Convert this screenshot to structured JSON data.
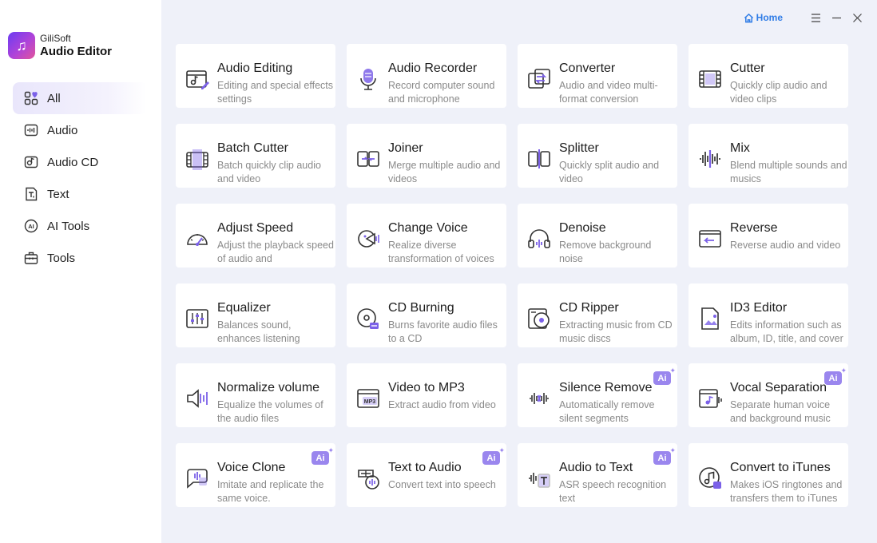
{
  "brand": {
    "company": "GiliSoft",
    "product": "Audio Editor"
  },
  "titlebar": {
    "home_label": "Home"
  },
  "sidebar": {
    "items": [
      {
        "label": "All",
        "icon": "grid-icon",
        "active": true
      },
      {
        "label": "Audio",
        "icon": "audio-icon"
      },
      {
        "label": "Audio CD",
        "icon": "cd-icon"
      },
      {
        "label": "Text",
        "icon": "text-icon"
      },
      {
        "label": "AI Tools",
        "icon": "ai-icon"
      },
      {
        "label": "Tools",
        "icon": "toolbox-icon"
      }
    ]
  },
  "tools": [
    {
      "title": "Audio Editing",
      "desc": "Editing and special effects settings",
      "icon": "audio-editing-icon",
      "ai": false
    },
    {
      "title": "Audio Recorder",
      "desc": "Record computer sound and microphone",
      "icon": "microphone-icon",
      "ai": false
    },
    {
      "title": "Converter",
      "desc": "Audio and video multi-format conversion",
      "icon": "converter-icon",
      "ai": false
    },
    {
      "title": "Cutter",
      "desc": "Quickly clip audio and video clips",
      "icon": "film-cut-icon",
      "ai": false
    },
    {
      "title": "Batch Cutter",
      "desc": "Batch quickly clip audio and video",
      "icon": "batch-cut-icon",
      "ai": false
    },
    {
      "title": "Joiner",
      "desc": "Merge multiple audio and videos",
      "icon": "joiner-icon",
      "ai": false
    },
    {
      "title": "Splitter",
      "desc": "Quickly split audio and video",
      "icon": "splitter-icon",
      "ai": false
    },
    {
      "title": "Mix",
      "desc": "Blend multiple sounds and musics",
      "icon": "waveform-icon",
      "ai": false
    },
    {
      "title": "Adjust Speed",
      "desc": "Adjust the playback speed of audio and",
      "icon": "speedometer-icon",
      "ai": false
    },
    {
      "title": "Change Voice",
      "desc": "Realize diverse transformation of voices",
      "icon": "voice-change-icon",
      "ai": false
    },
    {
      "title": "Denoise",
      "desc": "Remove background noise",
      "icon": "headphones-icon",
      "ai": false
    },
    {
      "title": "Reverse",
      "desc": "Reverse audio and video",
      "icon": "reverse-icon",
      "ai": false
    },
    {
      "title": "Equalizer",
      "desc": "Balances sound, enhances listening",
      "icon": "equalizer-icon",
      "ai": false
    },
    {
      "title": "CD Burning",
      "desc": "Burns favorite audio files to a CD",
      "icon": "cd-burn-icon",
      "ai": false
    },
    {
      "title": "CD Ripper",
      "desc": "Extracting music from CD music discs",
      "icon": "cd-ripper-icon",
      "ai": false
    },
    {
      "title": "ID3 Editor",
      "desc": "Edits information such as album, ID, title, and cover",
      "icon": "id3-icon",
      "ai": false
    },
    {
      "title": "Normalize volume",
      "desc": "Equalize the volumes of the audio files",
      "icon": "volume-icon",
      "ai": false
    },
    {
      "title": "Video to MP3",
      "desc": "Extract audio from video",
      "icon": "mp3-icon",
      "ai": false
    },
    {
      "title": "Silence Remove",
      "desc": "Automatically remove silent segments",
      "icon": "silence-icon",
      "ai": true
    },
    {
      "title": "Vocal Separation",
      "desc": "Separate human voice and background music",
      "icon": "vocal-icon",
      "ai": true
    },
    {
      "title": "Voice Clone",
      "desc": "Imitate and replicate the same voice.",
      "icon": "voice-clone-icon",
      "ai": true
    },
    {
      "title": "Text to Audio",
      "desc": "Convert text into speech",
      "icon": "text-to-audio-icon",
      "ai": true
    },
    {
      "title": "Audio to Text",
      "desc": "ASR speech recognition text",
      "icon": "audio-to-text-icon",
      "ai": true
    },
    {
      "title": "Convert to iTunes",
      "desc": "Makes iOS ringtones and transfers them to iTunes",
      "icon": "itunes-icon",
      "ai": false
    }
  ],
  "ai_badge_label": "Ai",
  "colors": {
    "accent": "#7b61e8",
    "ai_badge": "#9a86ee",
    "home_link": "#2f7ce6"
  }
}
